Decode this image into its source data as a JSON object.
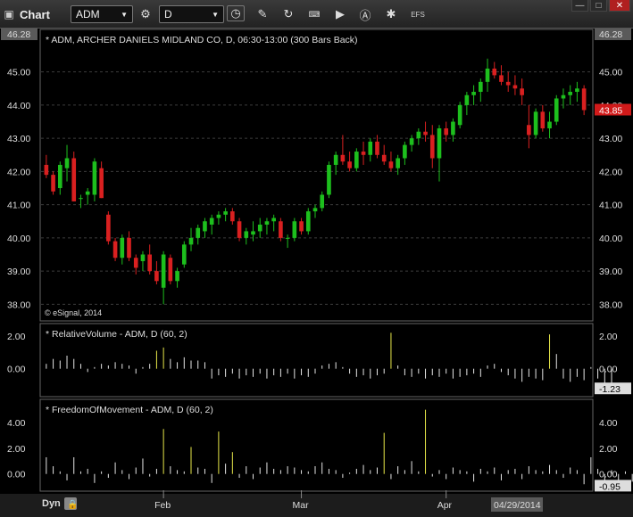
{
  "toolbar": {
    "app_title": "Chart",
    "symbol": "ADM",
    "interval": "D",
    "efs_label": "EFS",
    "win_min": "—",
    "win_max": "□",
    "win_close": "✕"
  },
  "price_pane": {
    "header": "* ADM, ARCHER DANIELS MIDLAND CO, D, 06:30-13:00 (300 Bars Back)",
    "copyright": "© eSignal, 2014",
    "top_value": "46.28",
    "last_price": "43.85",
    "last_price_color": "#d11a1a",
    "up_color": "#1dbf1d",
    "down_color": "#d92020",
    "ticks": [
      "45.00",
      "44.00",
      "43.00",
      "42.00",
      "41.00",
      "40.00",
      "39.00",
      "38.00"
    ]
  },
  "rv_pane": {
    "header": "* RelativeVolume - ADM, D (60, 2)",
    "ticks": [
      "2.00",
      "0.00"
    ],
    "last_value": "-1.23",
    "highlight_color": "#e8e84a"
  },
  "fom_pane": {
    "header": "* FreedomOfMovement - ADM, D (60, 2)",
    "ticks": [
      "4.00",
      "2.00",
      "0.00"
    ],
    "last_value": "-0.95"
  },
  "x_axis": {
    "dyn_label": "Dyn",
    "months": [
      "Feb",
      "Mar",
      "Apr"
    ],
    "cursor_date": "04/29/2014"
  },
  "chart_data": [
    {
      "type": "candlestick",
      "title": "* ADM, ARCHER DANIELS MIDLAND CO, D, 06:30-13:00 (300 Bars Back)",
      "ylim": [
        37.5,
        46.28
      ],
      "x_ticks": [
        "Feb",
        "Mar",
        "Apr"
      ],
      "ohlc": [
        [
          42.2,
          42.5,
          41.8,
          41.9
        ],
        [
          41.9,
          42.0,
          41.3,
          41.4
        ],
        [
          41.5,
          42.3,
          41.3,
          42.2
        ],
        [
          42.1,
          42.8,
          41.7,
          42.4
        ],
        [
          42.4,
          42.6,
          41.1,
          41.1
        ],
        [
          41.2,
          41.3,
          40.9,
          41.2
        ],
        [
          41.3,
          41.5,
          41.0,
          41.4
        ],
        [
          41.3,
          42.4,
          41.1,
          42.3
        ],
        [
          42.1,
          42.3,
          41.2,
          41.2
        ],
        [
          40.7,
          40.8,
          39.8,
          39.9
        ],
        [
          39.9,
          40.0,
          39.3,
          39.4
        ],
        [
          39.4,
          40.1,
          39.2,
          40.0
        ],
        [
          40.0,
          40.2,
          39.3,
          39.4
        ],
        [
          39.4,
          39.5,
          38.9,
          39.1
        ],
        [
          39.3,
          39.6,
          39.0,
          39.5
        ],
        [
          39.5,
          39.8,
          38.9,
          39.0
        ],
        [
          39.0,
          39.3,
          38.6,
          38.7
        ],
        [
          38.5,
          39.6,
          38.0,
          39.5
        ],
        [
          39.4,
          39.5,
          38.6,
          38.7
        ],
        [
          38.7,
          39.1,
          38.5,
          39.0
        ],
        [
          39.2,
          39.9,
          39.1,
          39.8
        ],
        [
          39.8,
          40.3,
          39.6,
          40.0
        ],
        [
          40.0,
          40.4,
          39.8,
          40.3
        ],
        [
          40.2,
          40.6,
          40.0,
          40.5
        ],
        [
          40.4,
          40.7,
          40.1,
          40.6
        ],
        [
          40.6,
          40.8,
          40.4,
          40.7
        ],
        [
          40.7,
          40.9,
          40.5,
          40.8
        ],
        [
          40.8,
          40.9,
          40.4,
          40.5
        ],
        [
          40.5,
          40.6,
          39.9,
          40.0
        ],
        [
          40.0,
          40.3,
          39.8,
          40.2
        ],
        [
          40.1,
          40.5,
          39.9,
          40.2
        ],
        [
          40.2,
          40.6,
          40.0,
          40.4
        ],
        [
          40.4,
          40.6,
          40.1,
          40.5
        ],
        [
          40.5,
          40.7,
          40.2,
          40.6
        ],
        [
          40.5,
          40.6,
          39.9,
          40.0
        ],
        [
          40.0,
          40.1,
          39.7,
          40.0
        ],
        [
          40.0,
          40.6,
          39.9,
          40.5
        ],
        [
          40.5,
          40.6,
          40.1,
          40.2
        ],
        [
          40.2,
          40.9,
          40.1,
          40.8
        ],
        [
          40.8,
          41.0,
          40.6,
          40.9
        ],
        [
          40.9,
          41.4,
          40.8,
          41.3
        ],
        [
          41.3,
          42.3,
          41.2,
          42.2
        ],
        [
          42.2,
          42.6,
          41.9,
          42.5
        ],
        [
          42.5,
          43.1,
          42.2,
          42.3
        ],
        [
          42.3,
          42.6,
          42.0,
          42.1
        ],
        [
          42.1,
          42.7,
          42.0,
          42.6
        ],
        [
          42.6,
          42.9,
          42.2,
          42.5
        ],
        [
          42.5,
          43.0,
          42.3,
          42.9
        ],
        [
          42.9,
          43.1,
          42.4,
          42.5
        ],
        [
          42.5,
          42.8,
          42.2,
          42.3
        ],
        [
          42.3,
          42.6,
          42.0,
          42.1
        ],
        [
          42.1,
          42.5,
          41.9,
          42.4
        ],
        [
          42.4,
          42.9,
          42.2,
          42.8
        ],
        [
          42.8,
          43.1,
          42.6,
          43.0
        ],
        [
          43.0,
          43.3,
          42.8,
          43.2
        ],
        [
          43.2,
          43.5,
          42.9,
          43.1
        ],
        [
          43.1,
          43.4,
          42.1,
          42.4
        ],
        [
          42.4,
          43.4,
          41.7,
          43.3
        ],
        [
          43.3,
          43.5,
          42.9,
          43.1
        ],
        [
          43.1,
          43.6,
          42.9,
          43.5
        ],
        [
          43.4,
          44.1,
          43.3,
          44.0
        ],
        [
          44.0,
          44.4,
          43.7,
          44.3
        ],
        [
          44.3,
          44.6,
          44.0,
          44.4
        ],
        [
          44.4,
          44.8,
          44.1,
          44.7
        ],
        [
          44.7,
          45.4,
          44.4,
          45.1
        ],
        [
          45.1,
          45.3,
          44.8,
          44.9
        ],
        [
          44.9,
          45.2,
          44.6,
          44.7
        ],
        [
          44.7,
          45.0,
          44.4,
          44.6
        ],
        [
          44.6,
          44.9,
          44.3,
          44.5
        ],
        [
          44.5,
          44.8,
          44.0,
          44.3
        ],
        [
          43.4,
          44.0,
          42.7,
          43.1
        ],
        [
          43.1,
          43.9,
          43.0,
          43.8
        ],
        [
          43.8,
          44.0,
          43.2,
          43.3
        ],
        [
          43.3,
          43.8,
          43.0,
          43.5
        ],
        [
          43.5,
          44.3,
          43.4,
          44.2
        ],
        [
          44.2,
          44.5,
          43.9,
          44.3
        ],
        [
          44.3,
          44.6,
          44.0,
          44.4
        ],
        [
          44.4,
          44.7,
          44.1,
          44.5
        ],
        [
          44.5,
          44.6,
          43.7,
          43.85
        ]
      ]
    },
    {
      "type": "bar",
      "title": "* RelativeVolume - ADM, D (60, 2)",
      "ylim": [
        -1.6,
        2.6
      ],
      "values": [
        0.3,
        0.6,
        0.5,
        0.8,
        0.6,
        0.3,
        -0.2,
        0.1,
        0.3,
        0.2,
        0.4,
        0.3,
        0.2,
        -0.3,
        0.1,
        0.3,
        1.1,
        1.3,
        0.6,
        0.4,
        0.7,
        0.5,
        0.5,
        0.4,
        -0.6,
        -0.4,
        -0.5,
        -0.3,
        -0.6,
        -0.4,
        -0.5,
        -0.3,
        -0.6,
        -0.4,
        -0.5,
        -0.3,
        -0.6,
        -0.4,
        -0.5,
        -0.3,
        0.2,
        0.3,
        0.4,
        0.1,
        -0.3,
        -0.5,
        -0.4,
        -0.6,
        -0.4,
        -0.3,
        2.2,
        0.2,
        -0.4,
        -0.5,
        -0.3,
        -0.6,
        -0.4,
        -0.5,
        -0.3,
        -0.6,
        -0.5,
        -0.4,
        -0.3,
        -0.5,
        0.2,
        0.3,
        -0.2,
        -0.4,
        -0.6,
        -0.8,
        -0.5,
        -0.6,
        -0.7,
        2.1,
        0.9,
        -0.6,
        -0.8,
        -0.5,
        -0.7,
        0.1,
        -0.6,
        -1.0,
        -1.23
      ],
      "highlight_indices": [
        16,
        17,
        50,
        73
      ]
    },
    {
      "type": "bar",
      "title": "* FreedomOfMovement - ADM, D (60, 2)",
      "ylim": [
        -1.2,
        5.6
      ],
      "values": [
        1.3,
        0.6,
        0.2,
        -0.5,
        1.3,
        0.2,
        0.4,
        -0.7,
        0.2,
        -0.3,
        0.9,
        0.3,
        -0.4,
        0.5,
        1.2,
        -0.2,
        0.4,
        3.5,
        0.6,
        0.3,
        0.2,
        2.1,
        0.5,
        0.4,
        -0.7,
        3.3,
        0.8,
        1.7,
        -0.3,
        0.6,
        -0.4,
        0.5,
        0.9,
        0.4,
        0.3,
        0.6,
        0.5,
        0.3,
        0.2,
        0.6,
        0.9,
        0.4,
        0.3,
        -0.3,
        0.1,
        0.4,
        0.7,
        0.3,
        0.5,
        3.2,
        -0.4,
        0.6,
        0.3,
        1.0,
        0.2,
        5.0,
        -0.2,
        0.3,
        -0.4,
        0.5,
        0.3,
        0.2,
        -0.6,
        0.4,
        0.2,
        0.5,
        -0.5,
        0.3,
        0.4,
        -0.4,
        0.6,
        0.3,
        0.2,
        0.7,
        0.3,
        -0.3,
        0.5,
        0.3,
        -0.8,
        1.3,
        0.4,
        -0.6,
        0.3,
        -0.5,
        0.2,
        -0.6,
        -0.95
      ],
      "highlight_indices": [
        17,
        21,
        25,
        27,
        49,
        55
      ]
    }
  ]
}
